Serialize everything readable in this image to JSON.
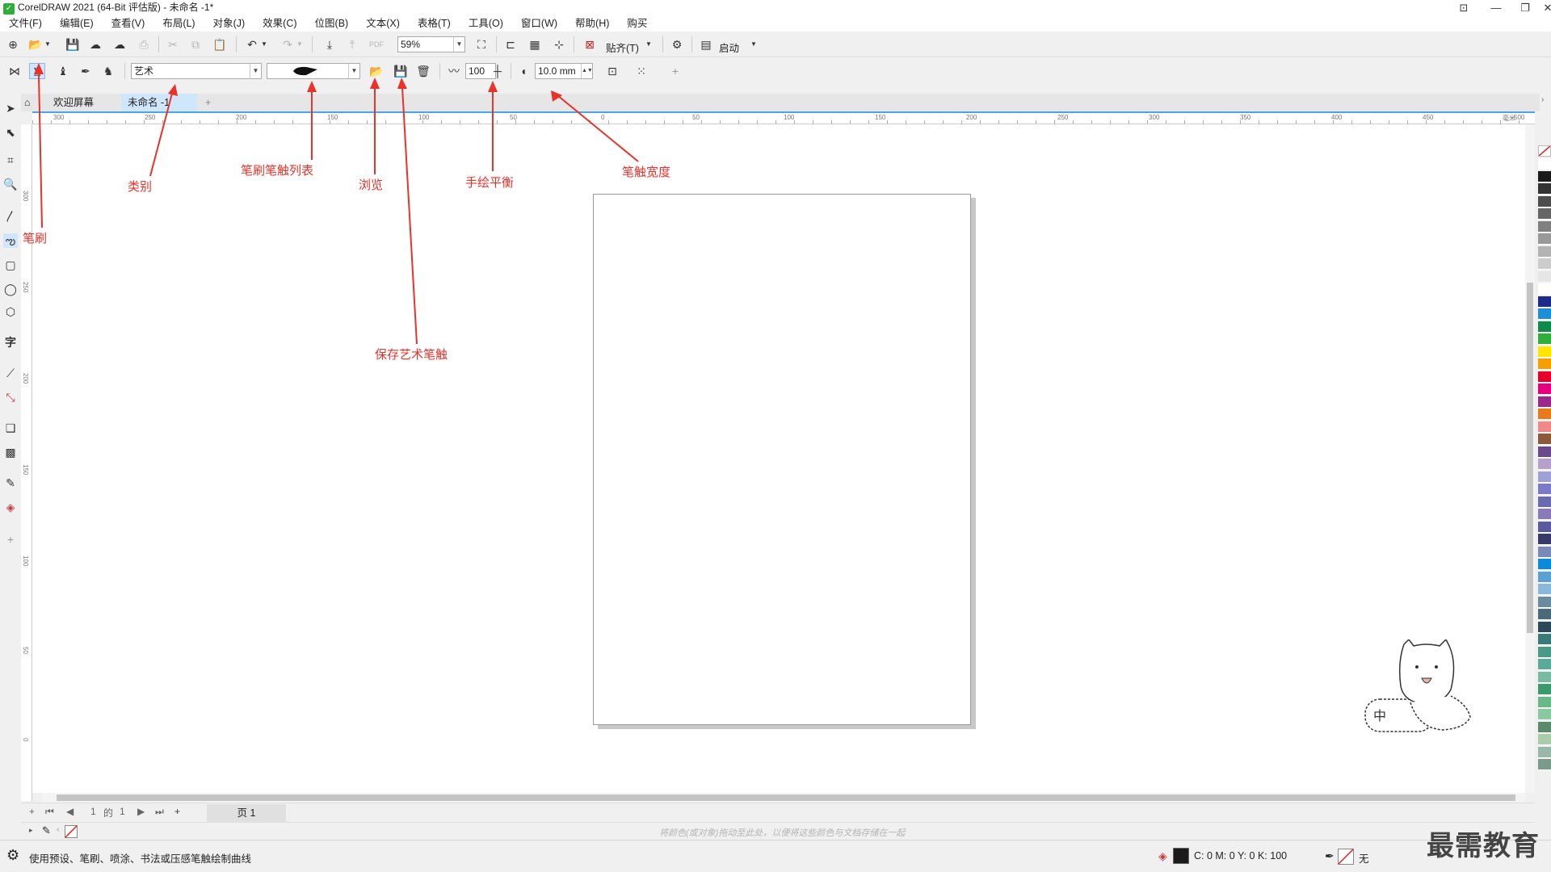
{
  "window": {
    "title": "CorelDRAW 2021 (64-Bit 评估版) - 未命名 -1*"
  },
  "menu": [
    "文件(F)",
    "编辑(E)",
    "查看(V)",
    "布局(L)",
    "对象(J)",
    "效果(C)",
    "位图(B)",
    "文本(X)",
    "表格(T)",
    "工具(O)",
    "窗口(W)",
    "帮助(H)",
    "购买"
  ],
  "std_toolbar": {
    "zoom": "59%",
    "snap_label": "贴齐(T)",
    "launch_label": "启动"
  },
  "prop_bar": {
    "category": "艺术",
    "smoothing": "100",
    "stroke_width": "10.0 mm"
  },
  "tabs": {
    "welcome": "欢迎屏幕",
    "document": "未命名 -1"
  },
  "ruler": {
    "h_labels": [
      "300",
      "250",
      "200",
      "150",
      "100",
      "50",
      "0",
      "50",
      "100",
      "150",
      "200",
      "250",
      "300",
      "350",
      "400",
      "450",
      "500"
    ],
    "h_unit": "毫米",
    "v_labels": [
      "300",
      "250",
      "200",
      "150",
      "100",
      "50",
      "0"
    ]
  },
  "page_nav": {
    "current": "1",
    "of_label": "的",
    "total": "1",
    "page_tab": "页 1"
  },
  "doc_palette_hint": "将颜色(或对象)拖动至此处，以便将这些颜色与文档存储在一起",
  "status": {
    "message": "使用预设、笔刷、喷涂、书法或压感笔触绘制曲线",
    "fill_cmyk": "C: 0 M: 0 Y: 0 K: 100",
    "outline": "无"
  },
  "annotations": {
    "brush": "笔刷",
    "category": "类别",
    "stroke_list": "笔刷笔触列表",
    "browse": "浏览",
    "freehand_smooth": "手绘平衡",
    "stroke_width": "笔触宽度",
    "save_stroke": "保存艺术笔触"
  },
  "mascot_text": "中",
  "brand": "最需教育",
  "colors": {
    "annotation": "#e8322a",
    "accent": "#49a5e6",
    "selected": "#cfe6fb"
  },
  "palette": [
    "#ffffff",
    "#1a1a1a",
    "#333333",
    "#4d4d4d",
    "#666666",
    "#808080",
    "#999999",
    "#b3b3b3",
    "#cccccc",
    "#e6e6e6",
    "#ffffff",
    "#1e2a8a",
    "#1c8fd8",
    "#0f8a4a",
    "#2fae3c",
    "#ffe600",
    "#f5a000",
    "#e4002b",
    "#e4007f",
    "#9a2a8a",
    "#e87a1e",
    "#f08a8a",
    "#8a5a3a",
    "#6a4a8a",
    "#b8a0cc",
    "#a0a0d8",
    "#7a7ac8",
    "#6a6ab0",
    "#8a7ab8",
    "#5a5aa0",
    "#3a3a6a",
    "#7a8ab8",
    "#0a8ad8",
    "#5aa0d0",
    "#8ab8d8",
    "#6a8aa0",
    "#4a6a7a",
    "#2a4a5a",
    "#3a7a7a",
    "#4a9a8a",
    "#5aaa9a",
    "#7abaa0",
    "#3a9a6a",
    "#6ab88a",
    "#8ac8a0",
    "#5a8a6a",
    "#aaccaa",
    "#9ab8aa",
    "#7a9a8a"
  ]
}
